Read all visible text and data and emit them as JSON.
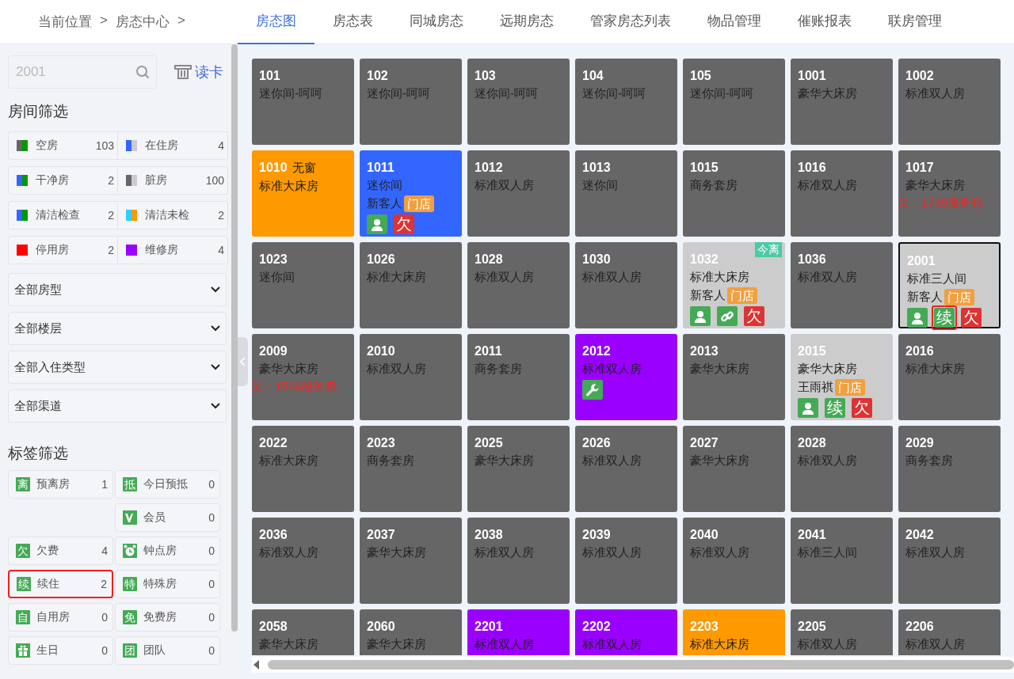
{
  "breadcrumb": {
    "label": "当前位置",
    "separator_1": ">",
    "current": "房态中心",
    "separator_2": ">"
  },
  "tabs": [
    {
      "label": "房态图",
      "selected": true
    },
    {
      "label": "房态表",
      "selected": false
    },
    {
      "label": "同城房态",
      "selected": false
    },
    {
      "label": "远期房态",
      "selected": false
    },
    {
      "label": "管家房态列表",
      "selected": false
    },
    {
      "label": "物品管理",
      "selected": false
    },
    {
      "label": "催账报表",
      "selected": false
    },
    {
      "label": "联房管理",
      "selected": false
    }
  ],
  "sidebar": {
    "search": {
      "placeholder": "2001"
    },
    "read_card": "读卡",
    "room_filter_title": "房间筛选",
    "room_filters": [
      {
        "label": "空房",
        "count": "103",
        "swatch": [
          {
            "color": "#666666"
          },
          {
            "color": "#009900"
          }
        ]
      },
      {
        "label": "在住房",
        "count": "4",
        "swatch": [
          {
            "color": "#3366ff"
          },
          {
            "color": "#cccccc"
          }
        ]
      },
      {
        "label": "干净房",
        "count": "2",
        "swatch": [
          {
            "color": "#3366ff"
          },
          {
            "color": "#009900"
          }
        ]
      },
      {
        "label": "脏房",
        "count": "100",
        "swatch": [
          {
            "color": "#666666"
          },
          {
            "color": "#cccccc"
          }
        ]
      },
      {
        "label": "清洁检查",
        "count": "2",
        "swatch": [
          {
            "color": "#3366ff"
          },
          {
            "color": "#009900"
          }
        ]
      },
      {
        "label": "清洁未检",
        "count": "2",
        "swatch": [
          {
            "color": "#33ccff"
          },
          {
            "color": "#ff9900"
          }
        ]
      },
      {
        "label": "停用房",
        "count": "2",
        "swatch": [
          {
            "color": "#ff0000"
          },
          {
            "color": "#ff0000"
          }
        ]
      },
      {
        "label": "维修房",
        "count": "4",
        "swatch": [
          {
            "color": "#9900ff"
          },
          {
            "color": "#9900ff"
          }
        ]
      }
    ],
    "dropdowns": [
      "全部房型",
      "全部楼层",
      "全部入住类型",
      "全部渠道"
    ],
    "tag_filter_title": "标签筛选",
    "tag_rows": [
      {
        "left": {
          "kind": "char",
          "icon": "离",
          "label": "预离房",
          "count": "1",
          "highlighted": false
        },
        "right": {
          "kind": "char",
          "icon": "抵",
          "label": "今日预抵",
          "count": "0",
          "highlighted": false
        }
      },
      {
        "right": {
          "kind": "vip",
          "label": "会员",
          "count": "0",
          "highlighted": false
        }
      },
      {
        "left": {
          "kind": "char",
          "icon": "欠",
          "label": "欠费",
          "count": "4",
          "highlighted": false
        },
        "right": {
          "kind": "clock",
          "label": "钟点房",
          "count": "0",
          "highlighted": false
        }
      },
      {
        "left": {
          "kind": "char",
          "icon": "续",
          "label": "续住",
          "count": "2",
          "highlighted": true
        },
        "right": {
          "kind": "char",
          "icon": "特",
          "label": "特殊房",
          "count": "0",
          "highlighted": false
        }
      },
      {
        "left": {
          "kind": "char",
          "icon": "自",
          "label": "自用房",
          "count": "0",
          "highlighted": false
        },
        "right": {
          "kind": "char",
          "icon": "免",
          "label": "免费房",
          "count": "0",
          "highlighted": false
        }
      },
      {
        "left": {
          "kind": "gift",
          "label": "生日",
          "count": "0",
          "highlighted": false
        },
        "right": {
          "kind": "char",
          "icon": "团",
          "label": "团队",
          "count": "0",
          "highlighted": false
        }
      }
    ]
  },
  "rooms": [
    {
      "number": "101",
      "type": "迷你间-呵呵",
      "color": "#666666",
      "selected": false
    },
    {
      "number": "102",
      "type": "迷你间-呵呵",
      "color": "#666666",
      "selected": false
    },
    {
      "number": "103",
      "type": "迷你间-呵呵",
      "color": "#666666",
      "selected": false
    },
    {
      "number": "104",
      "type": "迷你间-呵呵",
      "color": "#666666",
      "selected": false
    },
    {
      "number": "105",
      "type": "迷你间-呵呵",
      "color": "#666666",
      "selected": false
    },
    {
      "number": "1001",
      "type": "豪华大床房",
      "color": "#666666",
      "selected": false
    },
    {
      "number": "1002",
      "type": "标准双人房",
      "color": "#666666",
      "selected": false
    },
    {
      "number": "1010",
      "note": "无窗",
      "type": "标准大床房",
      "color": "#ff9900",
      "selected": false
    },
    {
      "number": "1011",
      "type": "迷你间",
      "guest": "新客人",
      "source": "门店",
      "badges": [
        {
          "kind": "guest",
          "highlighted": false
        },
        {
          "kind": "char",
          "text": "欠",
          "color": "#dd3333",
          "highlighted": false
        }
      ],
      "color": "#3366ff",
      "selected": false
    },
    {
      "number": "1012",
      "type": "标准双人房",
      "color": "#666666",
      "selected": false
    },
    {
      "number": "1013",
      "type": "迷你间",
      "color": "#666666",
      "selected": false
    },
    {
      "number": "1015",
      "type": "商务套房",
      "color": "#666666",
      "selected": false
    },
    {
      "number": "1016",
      "type": "标准双人房",
      "color": "#666666",
      "selected": false
    },
    {
      "number": "1017",
      "type": "豪华大床房",
      "debt": "欠：1739服务包",
      "color": "#666666",
      "selected": false
    },
    {
      "number": "1023",
      "type": "迷你间",
      "color": "#666666",
      "selected": false
    },
    {
      "number": "1026",
      "type": "标准大床房",
      "color": "#666666",
      "selected": false
    },
    {
      "number": "1028",
      "type": "标准双人房",
      "color": "#666666",
      "selected": false
    },
    {
      "number": "1030",
      "type": "标准双人房",
      "color": "#666666",
      "selected": false
    },
    {
      "number": "1032",
      "corner_tag": "今离",
      "type": "标准大床房",
      "guest": "新客人",
      "source": "门店",
      "badges": [
        {
          "kind": "guest",
          "highlighted": false
        },
        {
          "kind": "link",
          "highlighted": false
        },
        {
          "kind": "char",
          "text": "欠",
          "color": "#dd3333",
          "highlighted": false
        }
      ],
      "color": "#cccccc",
      "selected": false
    },
    {
      "number": "1036",
      "type": "标准双人房",
      "color": "#666666",
      "selected": false
    },
    {
      "number": "2001",
      "type": "标准三人间",
      "guest": "新客人",
      "source": "门店",
      "badges": [
        {
          "kind": "guest",
          "highlighted": false
        },
        {
          "kind": "char",
          "text": "续",
          "color": "#44aa55",
          "highlighted": true
        },
        {
          "kind": "char",
          "text": "欠",
          "color": "#dd3333",
          "highlighted": false
        }
      ],
      "color": "#cccccc",
      "selected": true
    },
    {
      "number": "2009",
      "type": "豪华大床房",
      "debt": "欠：1564服务包",
      "color": "#666666",
      "selected": false
    },
    {
      "number": "2010",
      "type": "标准双人房",
      "color": "#666666",
      "selected": false
    },
    {
      "number": "2011",
      "type": "商务套房",
      "color": "#666666",
      "selected": false
    },
    {
      "number": "2012",
      "type": "标准双人房",
      "badges": [
        {
          "kind": "repair",
          "highlighted": false
        }
      ],
      "color": "#9900ff",
      "selected": false
    },
    {
      "number": "2013",
      "type": "豪华大床房",
      "color": "#666666",
      "selected": false
    },
    {
      "number": "2015",
      "type": "豪华大床房",
      "guest": "王雨祺",
      "source": "门店",
      "badges": [
        {
          "kind": "guest",
          "highlighted": false
        },
        {
          "kind": "char",
          "text": "续",
          "color": "#44aa55",
          "highlighted": false
        },
        {
          "kind": "char",
          "text": "欠",
          "color": "#dd3333",
          "highlighted": false
        }
      ],
      "color": "#cccccc",
      "selected": false
    },
    {
      "number": "2016",
      "type": "标准大床房",
      "color": "#666666",
      "selected": false
    },
    {
      "number": "2022",
      "type": "标准大床房",
      "color": "#666666",
      "selected": false
    },
    {
      "number": "2023",
      "type": "商务套房",
      "color": "#666666",
      "selected": false
    },
    {
      "number": "2025",
      "type": "豪华大床房",
      "color": "#666666",
      "selected": false
    },
    {
      "number": "2026",
      "type": "标准双人房",
      "color": "#666666",
      "selected": false
    },
    {
      "number": "2027",
      "type": "豪华大床房",
      "color": "#666666",
      "selected": false
    },
    {
      "number": "2028",
      "type": "标准双人房",
      "color": "#666666",
      "selected": false
    },
    {
      "number": "2029",
      "type": "商务套房",
      "color": "#666666",
      "selected": false
    },
    {
      "number": "2036",
      "type": "标准双人房",
      "color": "#666666",
      "selected": false
    },
    {
      "number": "2037",
      "type": "豪华大床房",
      "color": "#666666",
      "selected": false
    },
    {
      "number": "2038",
      "type": "标准双人房",
      "color": "#666666",
      "selected": false
    },
    {
      "number": "2039",
      "type": "标准双人房",
      "color": "#666666",
      "selected": false
    },
    {
      "number": "2040",
      "type": "标准双人房",
      "color": "#666666",
      "selected": false
    },
    {
      "number": "2041",
      "type": "标准三人间",
      "color": "#666666",
      "selected": false
    },
    {
      "number": "2042",
      "type": "标准双人房",
      "color": "#666666",
      "selected": false
    },
    {
      "number": "2058",
      "type": "豪华大床房",
      "color": "#666666",
      "selected": false
    },
    {
      "number": "2060",
      "type": "豪华大床房",
      "color": "#666666",
      "selected": false
    },
    {
      "number": "2201",
      "type": "标准双人房",
      "color": "#9900ff",
      "selected": false
    },
    {
      "number": "2202",
      "type": "标准双人房",
      "color": "#9900ff",
      "selected": false
    },
    {
      "number": "2203",
      "type": "标准大床房",
      "color": "#ff9900",
      "selected": false
    },
    {
      "number": "2205",
      "type": "标准双人房",
      "color": "#666666",
      "selected": false
    },
    {
      "number": "2206",
      "type": "标准双人房",
      "color": "#666666",
      "selected": false
    }
  ]
}
